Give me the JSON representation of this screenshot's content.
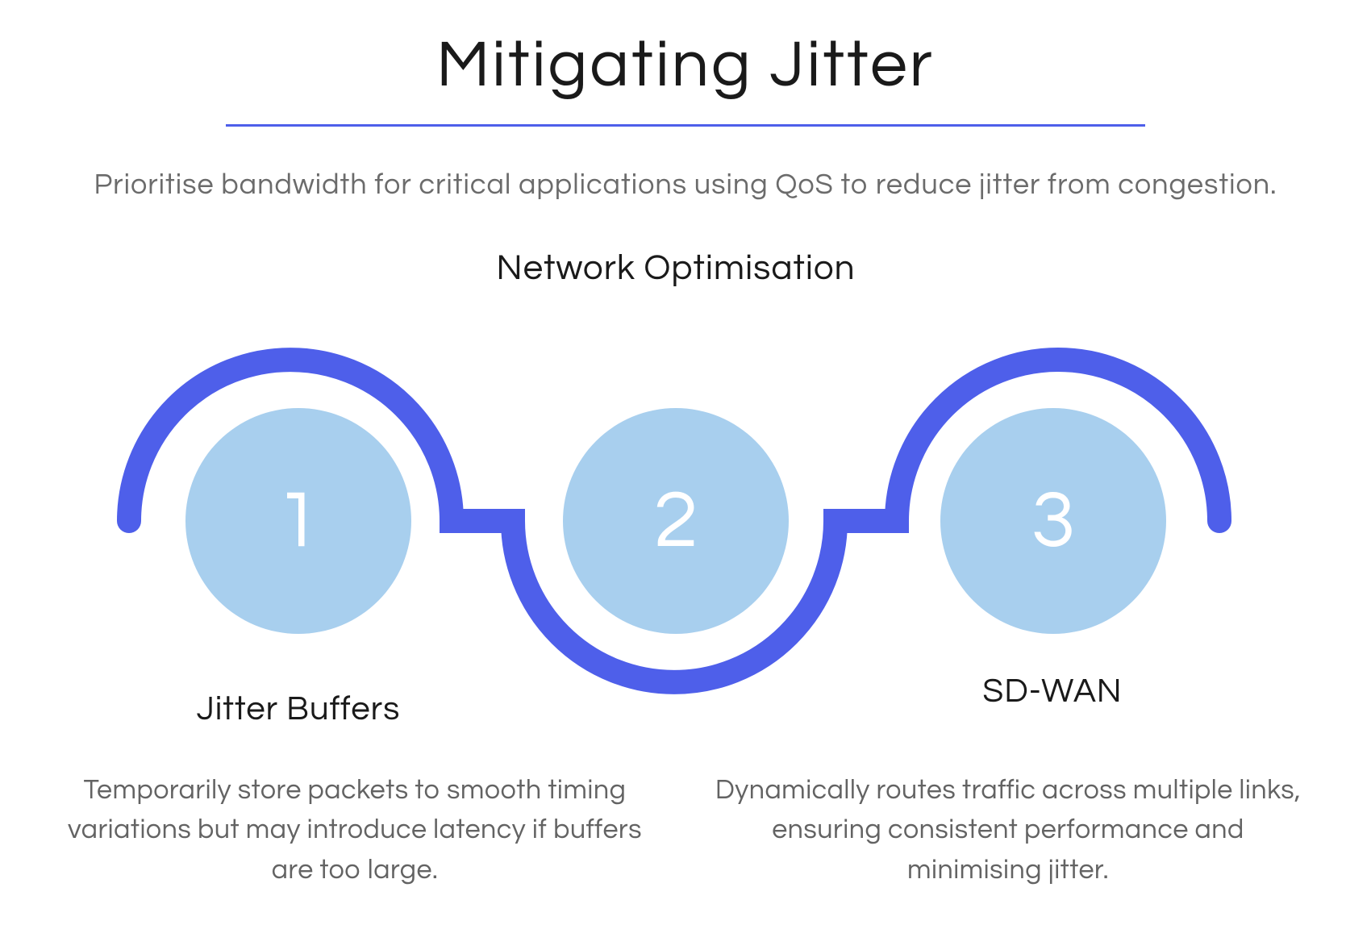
{
  "title": "Mitigating Jitter",
  "subtitle": "Prioritise bandwidth for critical applications using QoS to reduce jitter from congestion.",
  "steps": [
    {
      "number": "1",
      "label": "Jitter Buffers",
      "description": "Temporarily store packets to smooth timing variations but may introduce latency if buffers are too large."
    },
    {
      "number": "2",
      "label": "Network Optimisation",
      "description": ""
    },
    {
      "number": "3",
      "label": "SD-WAN",
      "description": "Dynamically routes traffic across multiple links, ensuring consistent performance and minimising jitter."
    }
  ],
  "colors": {
    "accent": "#4e5fea",
    "circle_fill": "#a8cfee",
    "text_dark": "#1a1a1a",
    "text_muted": "#6b6b6b"
  }
}
